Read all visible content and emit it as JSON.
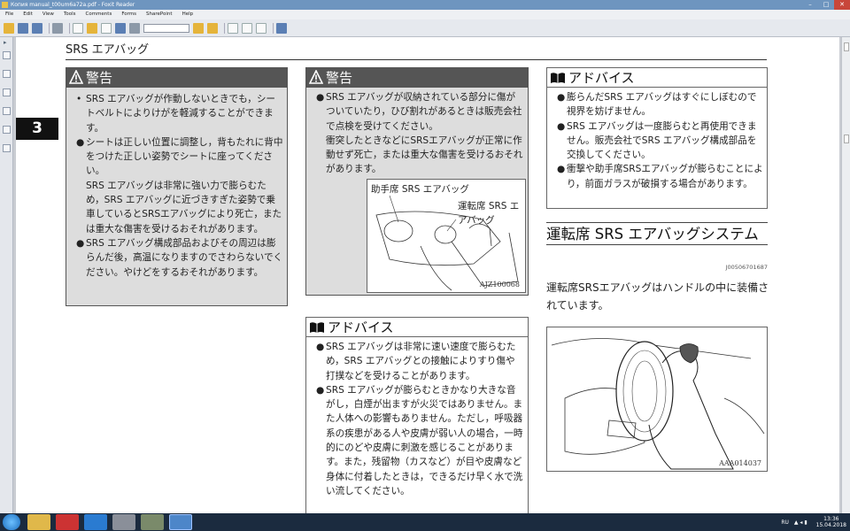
{
  "window": {
    "title": "Копия manual_t00um6a72a.pdf - Foxit Reader",
    "minimize": "–",
    "maximize": "□",
    "close": "✕"
  },
  "menu": [
    "File",
    "Edit",
    "View",
    "Tools",
    "Comments",
    "Forms",
    "SharePoint",
    "Help"
  ],
  "page": {
    "section_title": "SRS エアバッグ",
    "chapter_number": "3",
    "warning1": {
      "title": "警告",
      "items": [
        {
          "bullet": "•",
          "text": "SRS エアバッグが作動しないときでも，シートベルトによりけがを軽減することができます。"
        },
        {
          "bullet": "●",
          "text": "シートは正しい位置に調整し，背もたれに背中をつけた正しい姿勢でシートに座ってください。"
        },
        {
          "bullet": "",
          "text": "SRS エアバッグは非常に強い力で膨らむため，SRS エアバッグに近づきすぎた姿勢で乗車しているとSRSエアバッグにより死亡，または重大な傷害を受けるおそれがあります。"
        },
        {
          "bullet": "●",
          "text": "SRS エアバッグ構成部品およびその周辺は膨らんだ後，高温になりますのでさわらないでください。やけどをするおそれがあります。"
        }
      ]
    },
    "warning2": {
      "title": "警告",
      "items": [
        {
          "bullet": "●",
          "text": "SRS エアバッグが収納されている部分に傷がついていたり，ひび割れがあるときは販売会社で点検を受けてください。"
        },
        {
          "bullet": "",
          "text": "衝突したときなどにSRSエアバッグが正常に作動せず死亡，または重大な傷害を受けるおそれがあります。"
        }
      ],
      "figure": {
        "label_passenger": "助手席 SRS エアバッグ",
        "label_driver": "運転席 SRS エアバッグ",
        "code": "AJZ100068"
      }
    },
    "advice1": {
      "title": "アドバイス",
      "items": [
        {
          "bullet": "●",
          "text": "SRS エアバッグは非常に速い速度で膨らむため，SRS エアバッグとの接触によりすり傷や打撲などを受けることがあります。"
        },
        {
          "bullet": "●",
          "text": "SRS エアバッグが膨らむときかなり大きな音がし，白煙が出ますが火災ではありません。また人体への影響もありません。ただし，呼吸器系の疾患がある人や皮膚が弱い人の場合，一時的にのどや皮膚に刺激を感じることがあります。また，残留物（カスなど）が目や皮膚など身体に付着したときは，できるだけ早く水で洗い流してください。"
        }
      ]
    },
    "advice2": {
      "title": "アドバイス",
      "items": [
        {
          "bullet": "●",
          "text": "膨らんだSRS エアバッグはすぐにしぼむので視界を妨げません。"
        },
        {
          "bullet": "●",
          "text": "SRS エアバッグは一度膨らむと再使用できません。販売会社でSRS エアバッグ構成部品を交換してください。"
        },
        {
          "bullet": "●",
          "text": "衝撃や助手席SRSエアバッグが膨らむことにより，前面ガラスが破損する場合があります。"
        }
      ]
    },
    "heading2": "運転席 SRS エアバッグシステム",
    "code2": "J00506701687",
    "body": "運転席SRSエアバッグはハンドルの中に装備されています。",
    "figure2": {
      "code": "AAA014037"
    }
  },
  "taskbar": {
    "lang": "RU",
    "time": "13:36",
    "date": "15.04.2018"
  },
  "colors": {
    "warning_header": "#555555",
    "warning_bg": "#dddddd",
    "chapter_tab": "#111111",
    "taskbar": "#1b2b3f"
  }
}
